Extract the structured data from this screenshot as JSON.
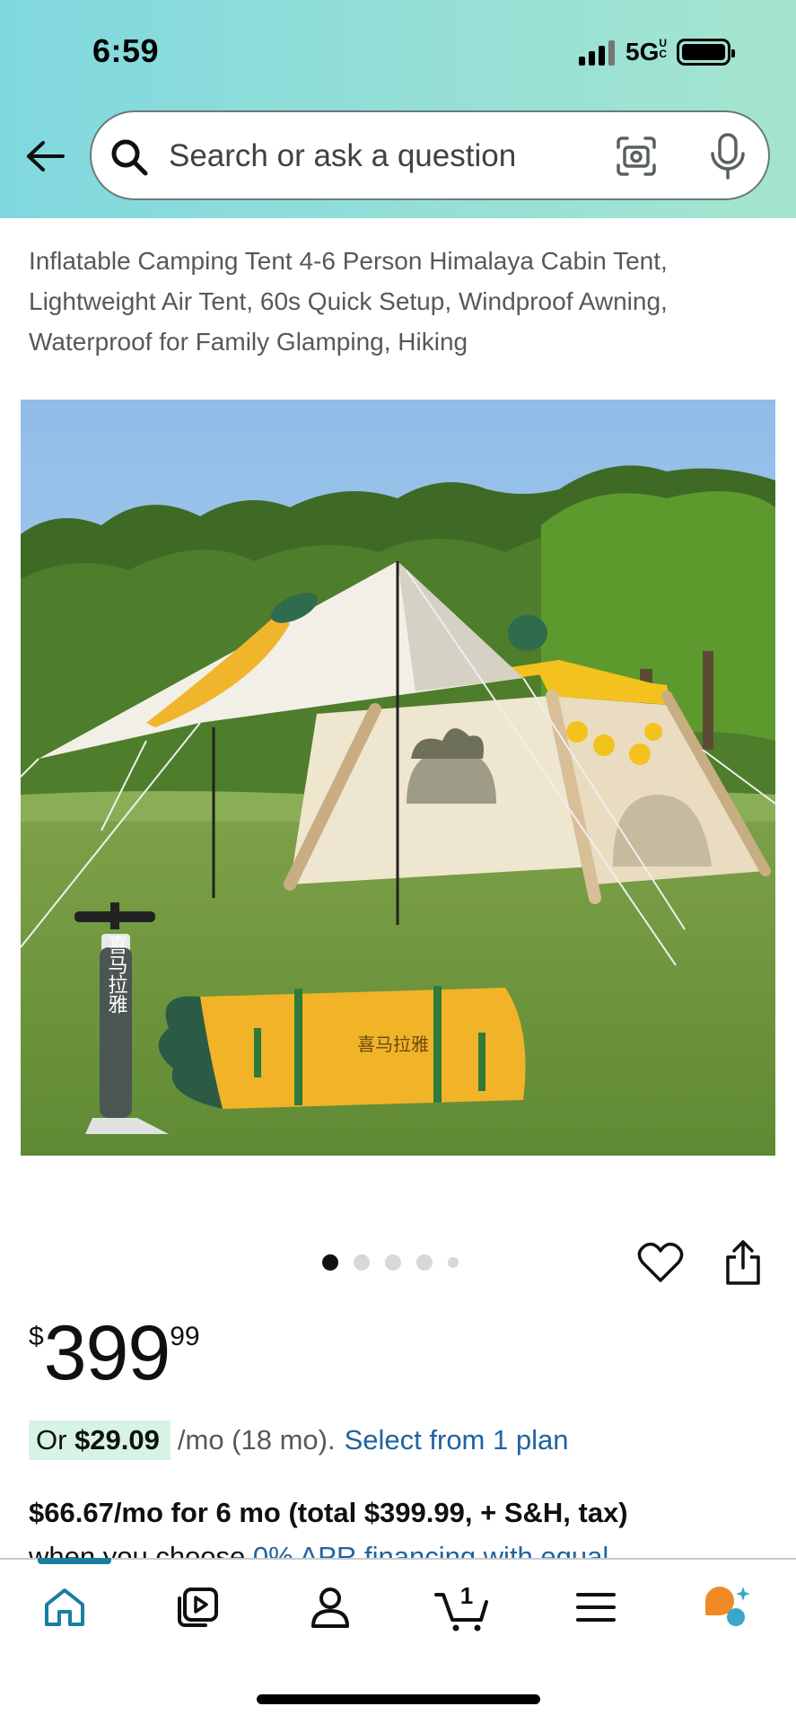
{
  "status_bar": {
    "time": "6:59",
    "network": "5G",
    "network_sup": "UC"
  },
  "search": {
    "placeholder": "Search or ask a question"
  },
  "product": {
    "title": "Inflatable Camping Tent 4-6 Person Himalaya Cabin Tent, Lightweight Air Tent, 60s Quick Setup, Windproof Awning, Waterproof for Family Glamping, Hiking",
    "image_brand_text": "喜马拉雅",
    "image_dots": 5,
    "active_image_index": 0
  },
  "price": {
    "symbol": "$",
    "whole": "399",
    "fraction": "99"
  },
  "installment": {
    "prefix": "Or",
    "amount": "$29.09",
    "term": "/mo (18 mo).",
    "link": "Select from 1 plan"
  },
  "financing": {
    "headline": "$66.67/mo for 6 mo (total $399.99, + S&H, tax)",
    "sub_prefix": "when you choose ",
    "sub_link": "0% APR financing with equal"
  },
  "bottom_nav": {
    "items": [
      "home-icon",
      "video-icon",
      "account-icon",
      "cart-icon",
      "menu-icon",
      "rufus-icon"
    ],
    "cart_count": "1",
    "active": "home"
  },
  "colors": {
    "header_start": "#80d8df",
    "header_end": "#a5e5cf",
    "link": "#2162a1",
    "installment_bg": "#d7f3e5",
    "nav_active": "#1a7ea0",
    "rufus_orange": "#f08a24",
    "rufus_teal": "#3aa6c9"
  }
}
